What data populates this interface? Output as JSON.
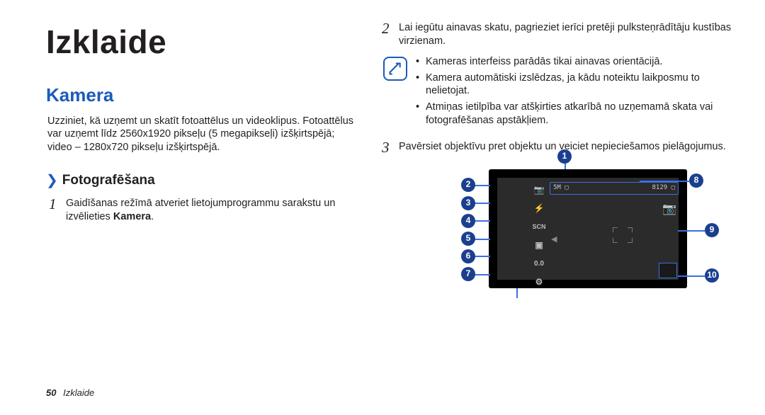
{
  "page": {
    "title": "Izklaide",
    "section_heading": "Kamera",
    "intro": "Uzziniet, kā uzņemt un skatīt fotoattēlus un videoklipus. Fotoattēlus var uzņemt līdz 2560x1920 pikseļu (5 megapikseļi) izšķirtspējā; video – 1280x720 pikseļu izšķirtspējā.",
    "sub_heading": "Fotografēšana",
    "step1": {
      "num": "1",
      "text_a": "Gaidīšanas režīmā atveriet lietojumprogrammu sarakstu un izvēlieties ",
      "text_b": "Kamera",
      "text_c": "."
    },
    "step2": {
      "num": "2",
      "text": "Lai iegūtu ainavas skatu, pagrieziet ierīci pretēji pulksteņrādītāju kustības virzienam."
    },
    "notes": [
      "Kameras interfeiss parādās tikai ainavas orientācijā.",
      "Kamera automātiski izslēdzas, ja kādu noteiktu laikposmu to nelietojat.",
      "Atmiņas ietilpība var atšķirties atkarībā no uzņemamā skata vai fotografēšanas apstākļiem."
    ],
    "step3": {
      "num": "3",
      "text": "Pavērsiet objektīvu pret objektu un veiciet nepieciešamos pielāgojumus."
    },
    "callouts": [
      "1",
      "2",
      "3",
      "4",
      "5",
      "6",
      "7",
      "8",
      "9",
      "10"
    ],
    "camera_ui": {
      "top_left": "5M ▢",
      "top_right": "8129 ▢",
      "left_icons": [
        "📷",
        "⚡",
        "SCN",
        "▣",
        "0.0",
        "⚙"
      ],
      "thumbnail": true
    },
    "footer": {
      "page_num": "50",
      "section": "Izklaide"
    }
  }
}
